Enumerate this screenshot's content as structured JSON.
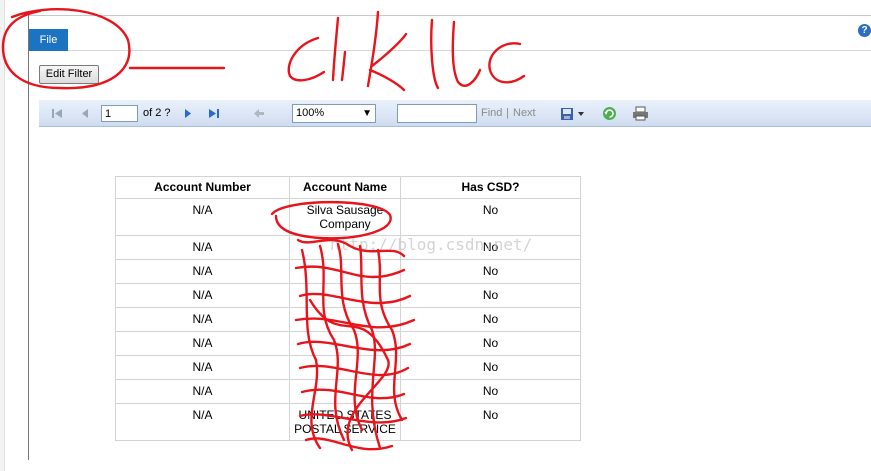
{
  "ribbon": {
    "file_tab": "File",
    "help_icon_glyph": "?"
  },
  "filter": {
    "edit_filter_label": "Edit Filter"
  },
  "toolbar": {
    "page_value": "1",
    "page_of": "of 2 ?",
    "zoom_value": "100%",
    "find_placeholder": "",
    "find_label": "Find",
    "separator": "|",
    "next_label": "Next",
    "icons": [
      "first-page-icon",
      "prev-page-icon",
      "next-page-icon",
      "last-page-icon",
      "back-icon",
      "export-icon",
      "refresh-icon",
      "print-icon"
    ]
  },
  "report": {
    "headers": [
      "Account Number",
      "Account Name",
      "Has CSD?"
    ],
    "rows": [
      [
        "N/A",
        "Silva Sausage Company",
        "No"
      ],
      [
        "N/A",
        "",
        "No"
      ],
      [
        "N/A",
        "",
        "No"
      ],
      [
        "N/A",
        "",
        "No"
      ],
      [
        "N/A",
        "",
        "No"
      ],
      [
        "N/A",
        "",
        "No"
      ],
      [
        "N/A",
        "",
        "No"
      ],
      [
        "N/A",
        "",
        "No"
      ],
      [
        "N/A",
        "UNITED STATES POSTAL SERVICE",
        "No"
      ]
    ]
  },
  "annotation": {
    "handwritten_text": "click",
    "watermark": "http://blog.csdn.net/",
    "ink_color": "#e8141c"
  }
}
